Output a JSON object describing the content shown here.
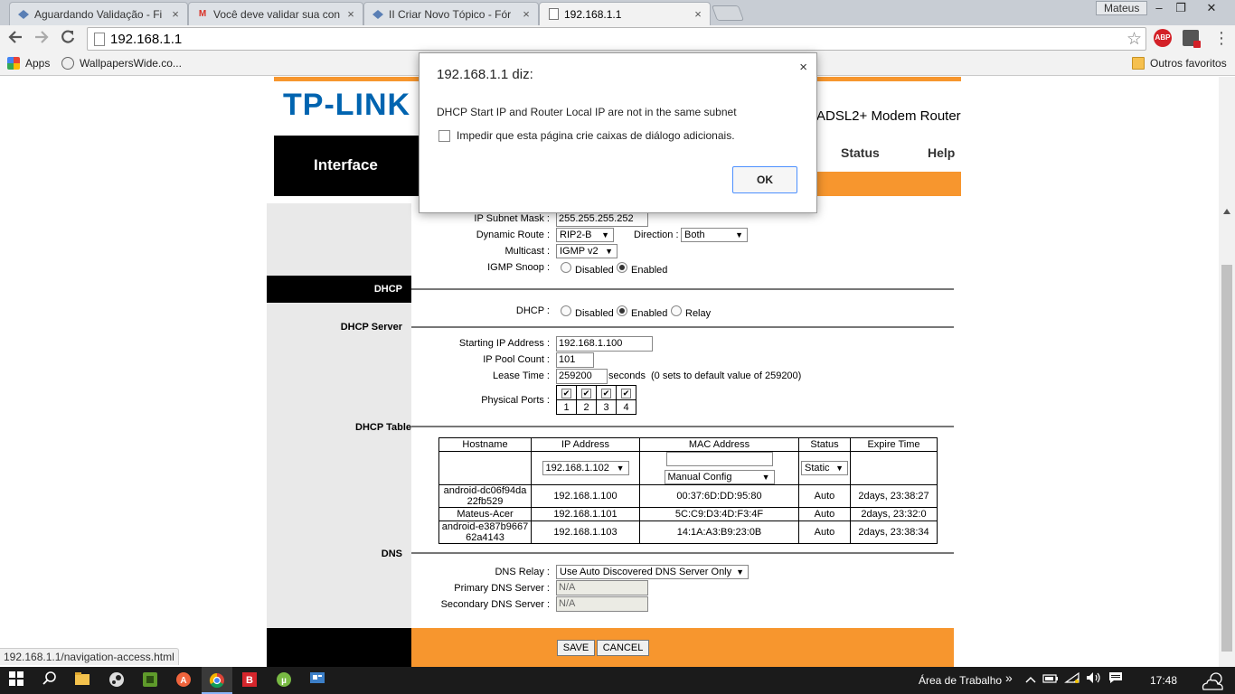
{
  "browser": {
    "tabs": [
      {
        "title": "Aguardando Validação - Fi",
        "icon": "forum-favicon"
      },
      {
        "title": "Você deve validar sua con",
        "icon": "gmail-favicon"
      },
      {
        "title": "II Criar Novo Tópico - Fór",
        "icon": "forum-favicon"
      },
      {
        "title": "192.168.1.1",
        "icon": "page-favicon"
      }
    ],
    "tab_close": "×",
    "profile_name": "Mateus",
    "window_controls": {
      "minimize": "‒",
      "restore": "❐",
      "close": "✕"
    },
    "url": "192.168.1.1",
    "bookmarks": {
      "apps": "Apps",
      "wallpapers": "WallpapersWide.co...",
      "other": "Outros favoritos"
    },
    "extensions": {
      "abp": "ABP"
    },
    "status_url": "192.168.1.1/navigation-access.html"
  },
  "router": {
    "logo": "TP-LINK",
    "product": "ADSL2+ Modem Router",
    "nav_title": "Interface",
    "nav_links": {
      "status": "Status",
      "help": "Help"
    },
    "wan": {
      "ip_subnet_mask_label": "IP Subnet Mask :",
      "ip_subnet_mask": "255.255.255.252",
      "dynamic_route_label": "Dynamic Route :",
      "dynamic_route": "RIP2-B",
      "direction_label": "Direction :",
      "direction": "Both",
      "multicast_label": "Multicast :",
      "multicast": "IGMP v2",
      "igmp_snoop_label": "IGMP Snoop :",
      "disabled": "Disabled",
      "enabled": "Enabled"
    },
    "dhcp": {
      "section_label": "DHCP",
      "dhcp_label": "DHCP :",
      "disabled": "Disabled",
      "enabled": "Enabled",
      "relay": "Relay",
      "server_section": "DHCP Server",
      "start_ip_label": "Starting IP Address :",
      "start_ip": "192.168.1.100",
      "pool_count_label": "IP Pool Count :",
      "pool_count": "101",
      "lease_time_label": "Lease Time :",
      "lease_time": "259200",
      "lease_unit": "seconds",
      "lease_note": "(0 sets to default value of 259200)",
      "ports_label": "Physical Ports :",
      "ports": [
        "1",
        "2",
        "3",
        "4"
      ],
      "table_section": "DHCP Table",
      "table": {
        "headers": [
          "Hostname",
          "IP Address",
          "MAC Address",
          "Status",
          "Expire Time"
        ],
        "edit_ip": "192.168.1.102",
        "edit_mac_mode": "Manual Config",
        "edit_status": "Static",
        "rows": [
          {
            "hostname": "android-dc06f94da22fb529",
            "ip": "192.168.1.100",
            "mac": "00:37:6D:DD:95:80",
            "status": "Auto",
            "expire": "2days, 23:38:27"
          },
          {
            "hostname": "Mateus-Acer",
            "ip": "192.168.1.101",
            "mac": "5C:C9:D3:4D:F3:4F",
            "status": "Auto",
            "expire": "2days, 23:32:0"
          },
          {
            "hostname": "android-e387b966762a4143",
            "ip": "192.168.1.103",
            "mac": "14:1A:A3:B9:23:0B",
            "status": "Auto",
            "expire": "2days, 23:38:34"
          }
        ]
      }
    },
    "dns": {
      "section_label": "DNS",
      "relay_label": "DNS Relay :",
      "relay": "Use Auto Discovered DNS Server Only",
      "primary_label": "Primary DNS Server :",
      "primary": "N/A",
      "secondary_label": "Secondary DNS Server :",
      "secondary": "N/A"
    },
    "buttons": {
      "save": "SAVE",
      "cancel": "CANCEL"
    }
  },
  "dialog": {
    "title": "192.168.1.1 diz:",
    "close": "×",
    "message": "DHCP Start IP and Router Local IP are not in the same subnet",
    "checkbox_label": "Impedir que esta página crie caixas de diálogo adicionais.",
    "ok": "OK"
  },
  "taskbar": {
    "desktop_label": "Área de Trabalho",
    "chevron": "»",
    "time": "17:48"
  }
}
